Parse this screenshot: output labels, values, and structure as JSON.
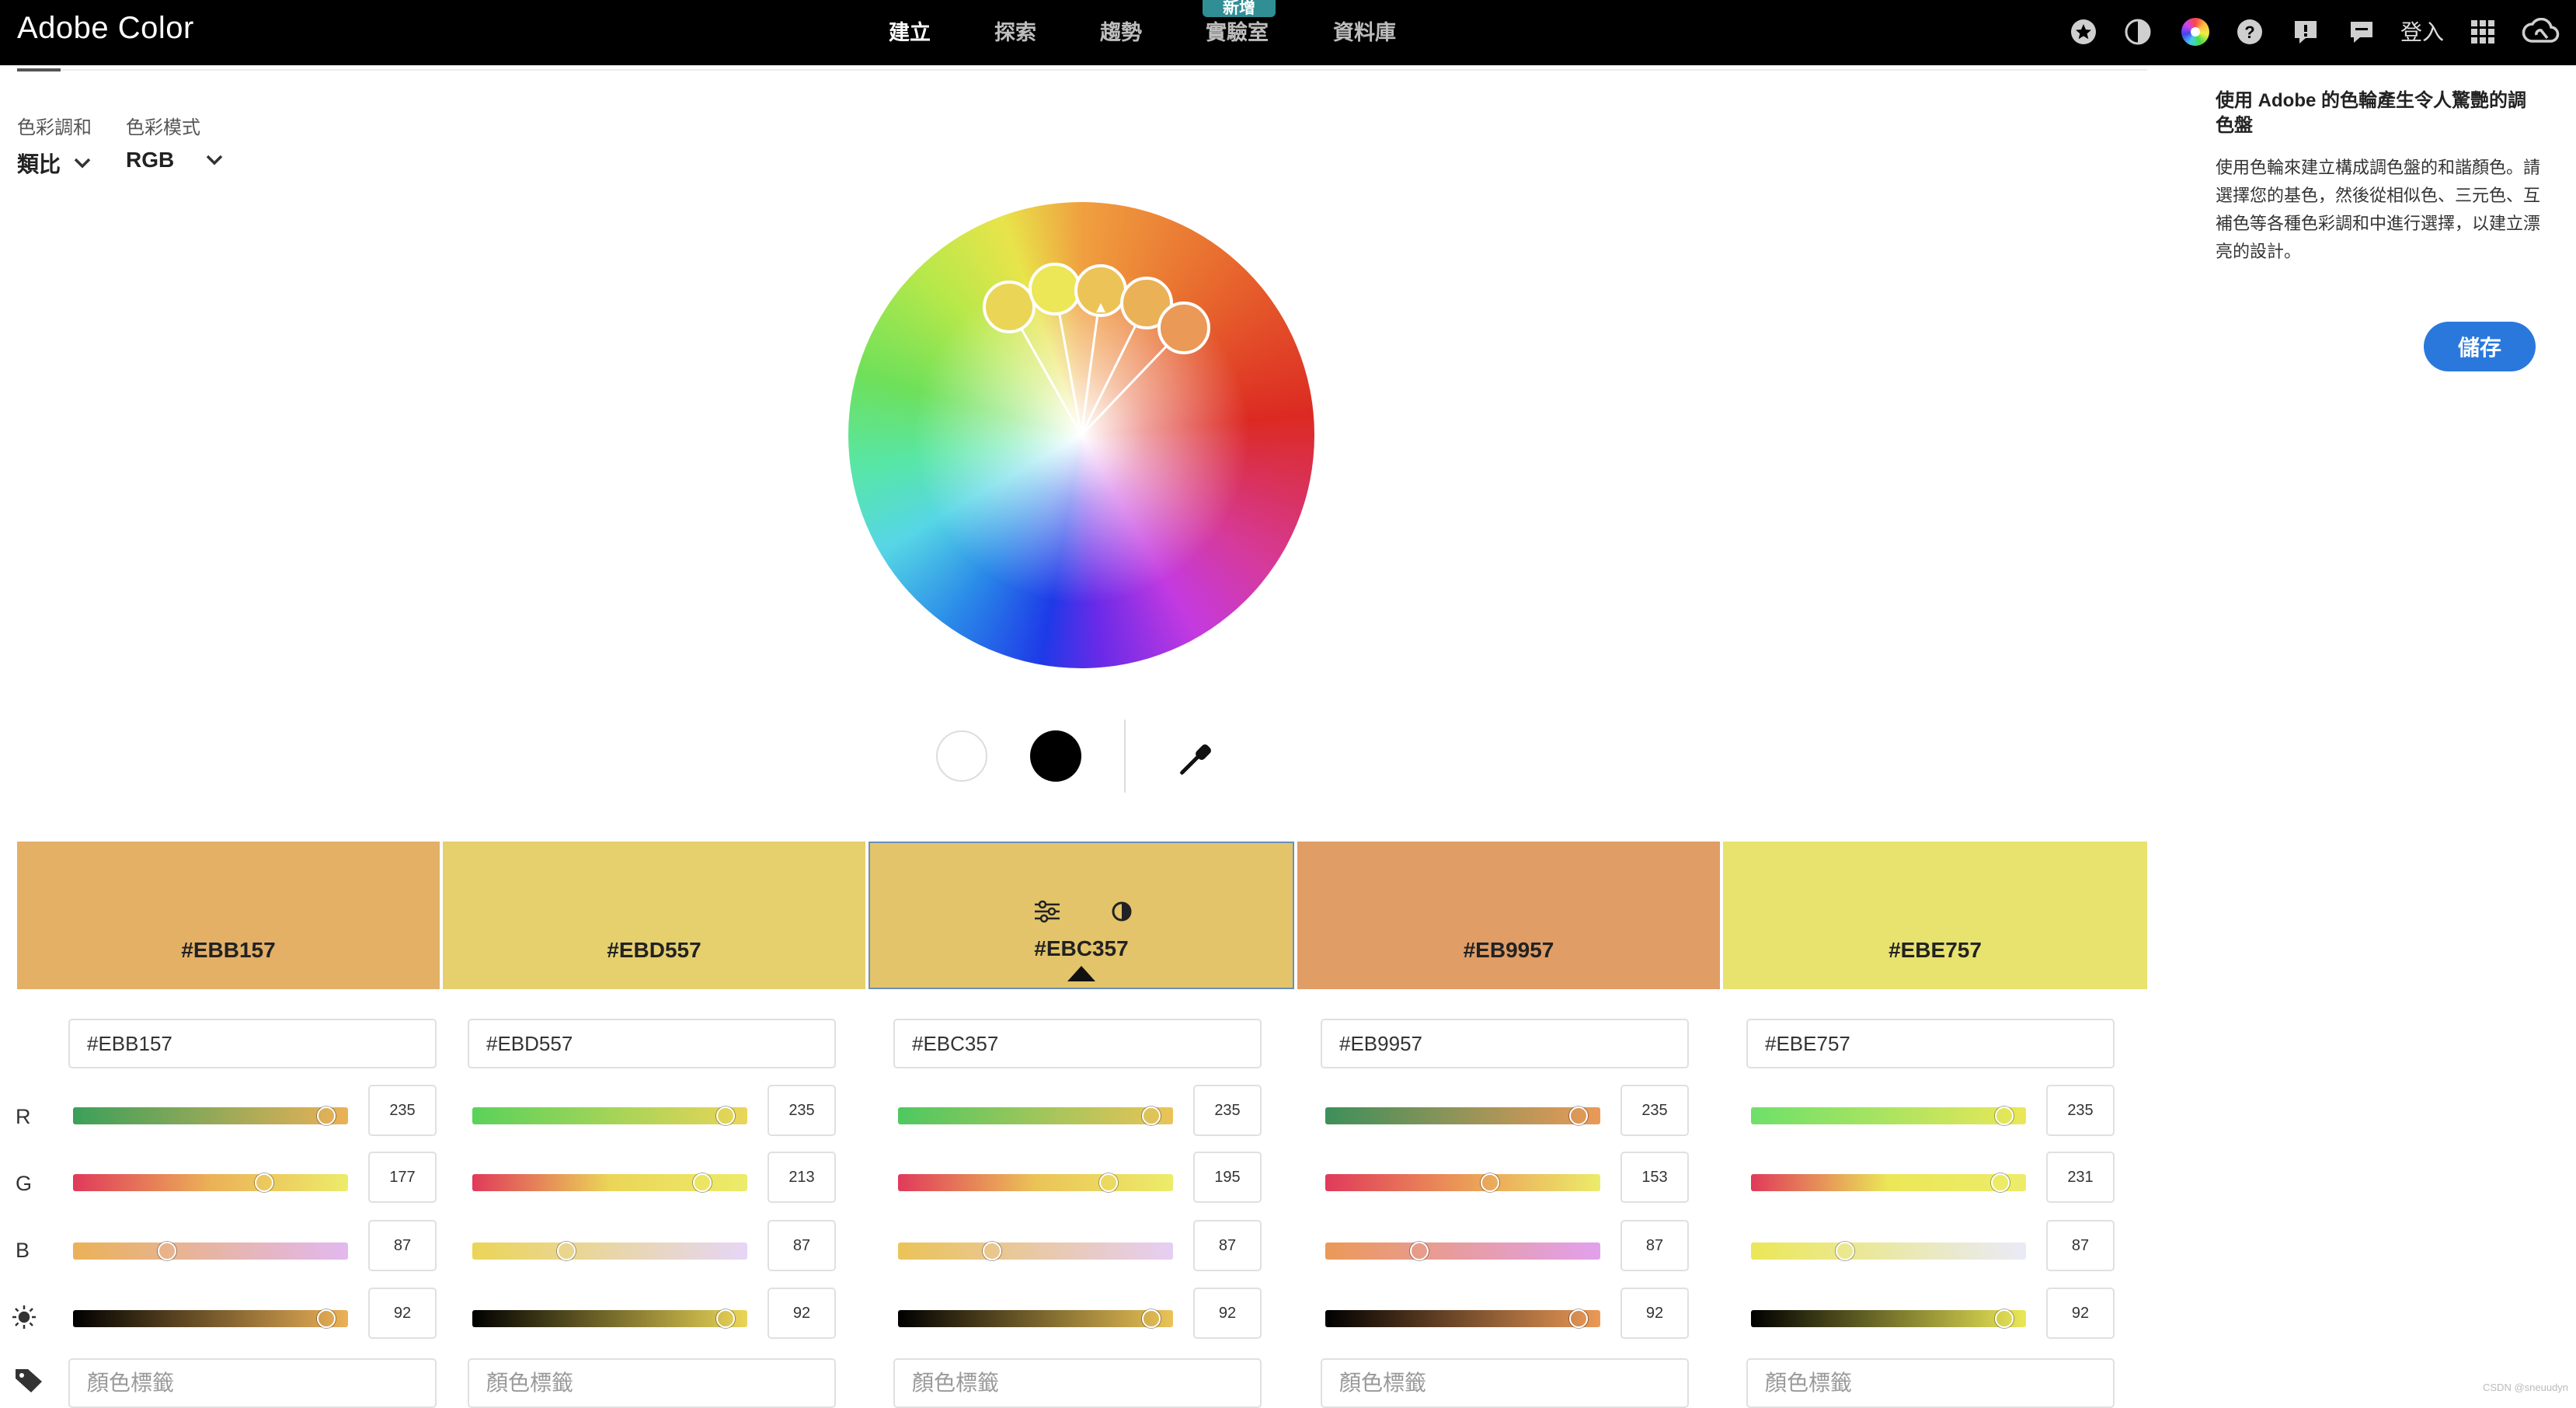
{
  "app": {
    "title": "Adobe Color"
  },
  "nav": {
    "items": [
      "建立",
      "探索",
      "趨勢",
      "實驗室",
      "資料庫"
    ],
    "badge": "新增"
  },
  "header": {
    "login": "登入"
  },
  "controls": {
    "harmony_label": "色彩調和",
    "harmony_value": "類比",
    "mode_label": "色彩模式",
    "mode_value": "RGB"
  },
  "swatches": [
    {
      "hex": "#EBB157",
      "r": "235",
      "g": "177",
      "b": "87",
      "brightness": "92",
      "tag_placeholder": "顏色標籤"
    },
    {
      "hex": "#EBD557",
      "r": "235",
      "g": "213",
      "b": "87",
      "brightness": "92",
      "tag_placeholder": "顏色標籤"
    },
    {
      "hex": "#EBC357",
      "r": "235",
      "g": "195",
      "b": "87",
      "brightness": "92",
      "tag_placeholder": "顏色標籤"
    },
    {
      "hex": "#EB9957",
      "r": "235",
      "g": "153",
      "b": "87",
      "brightness": "92",
      "tag_placeholder": "顏色標籤"
    },
    {
      "hex": "#EBE757",
      "r": "235",
      "g": "231",
      "b": "87",
      "brightness": "92",
      "tag_placeholder": "顏色標籤"
    }
  ],
  "swatch_colors": [
    "#E3B066",
    "#E6D06D",
    "#E3C46A",
    "#E09D66",
    "#E8E26F"
  ],
  "selected_swatch": 3,
  "channels": [
    "R",
    "G",
    "B"
  ],
  "panel": {
    "title": "使用 Adobe 的色輪產生令人驚艷的調色盤",
    "body": "使用色輪來建立構成調色盤的和諧顏色。請選擇您的基色，然後從相似色、三元色、互補色等各種色彩調和中進行選擇，以建立漂亮的設計。",
    "save_label": "儲存"
  },
  "footer": {
    "credit": "CSDN @sneuudyn"
  },
  "icons": [
    "star-icon",
    "contrast-icon",
    "color-wheel-icon",
    "help-icon",
    "feedback-icon",
    "chat-icon",
    "apps-grid-icon",
    "creative-cloud-icon",
    "chevron-down-icon",
    "eyedropper-icon",
    "sliders-icon",
    "brightness-icon",
    "tag-icon"
  ]
}
